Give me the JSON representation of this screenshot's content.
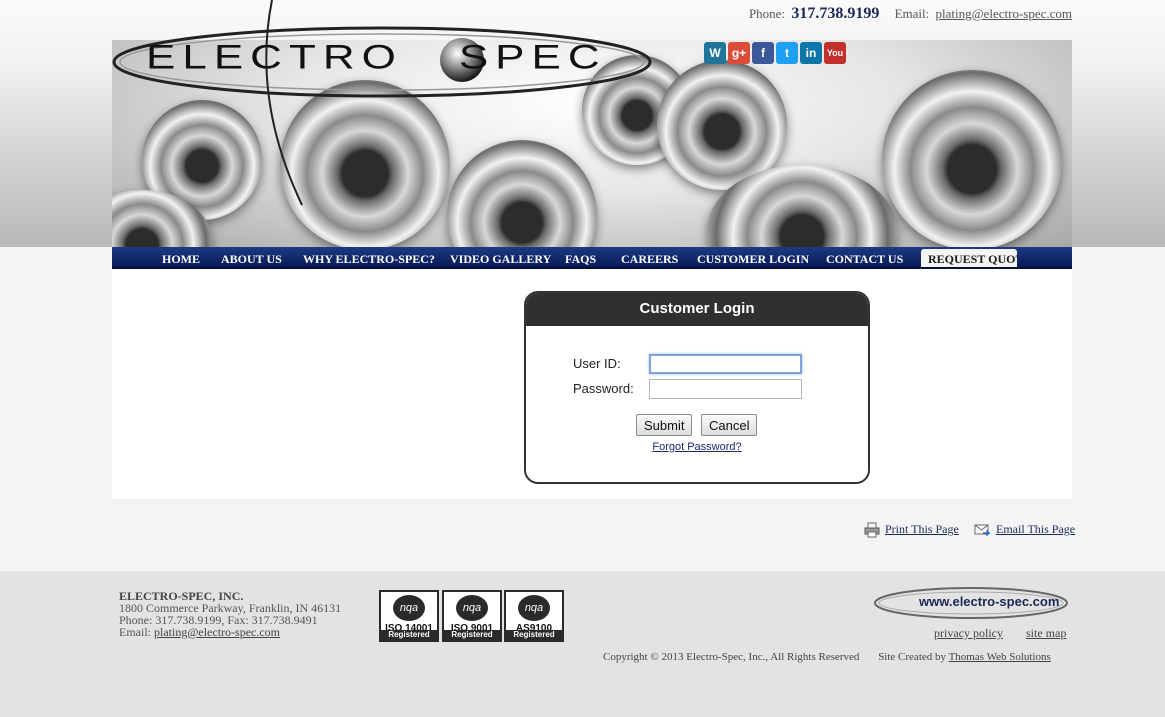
{
  "header": {
    "logo_text_left": "ELECTRO",
    "logo_text_right": "SPEC",
    "phone_label": "Phone:",
    "phone": "317.738.9199",
    "email_label": "Email:",
    "email": "plating@electro-spec.com",
    "social": [
      {
        "icon": "wordpress-icon",
        "glyph": "W",
        "color": "#21759b"
      },
      {
        "icon": "google-plus-icon",
        "glyph": "g+",
        "color": "#dd4b39"
      },
      {
        "icon": "facebook-icon",
        "glyph": "f",
        "color": "#3b5998"
      },
      {
        "icon": "twitter-icon",
        "glyph": "t",
        "color": "#1da1f2"
      },
      {
        "icon": "linkedin-icon",
        "glyph": "in",
        "color": "#0e76a8"
      },
      {
        "icon": "youtube-icon",
        "glyph": "You",
        "color": "#c4302b"
      }
    ]
  },
  "nav": {
    "items": [
      "HOME",
      "ABOUT US",
      "WHY ELECTRO-SPEC?",
      "VIDEO GALLERY",
      "FAQS",
      "CAREERS",
      "CUSTOMER LOGIN",
      "CONTACT US"
    ],
    "request_quote": "REQUEST QUOTE"
  },
  "login": {
    "title": "Customer Login",
    "user_label": "User ID:",
    "user_value": "",
    "password_label": "Password:",
    "password_value": "",
    "submit": "Submit",
    "cancel": "Cancel",
    "forgot": "Forgot Password?"
  },
  "utility": {
    "print": "Print This Page",
    "email": "Email This Page"
  },
  "footer": {
    "company": "ELECTRO-SPEC, INC.",
    "address": "1800 Commerce Parkway, Franklin, IN 46131",
    "phone_fax": "Phone: 317.738.9199, Fax: 317.738.9491",
    "email_label": "Email:",
    "email": "plating@electro-spec.com",
    "certs": [
      {
        "badge": "nqa",
        "standard": "ISO 14001",
        "label": "Registered"
      },
      {
        "badge": "nqa",
        "standard": "ISO 9001",
        "label": "Registered"
      },
      {
        "badge": "nqa",
        "standard": "AS9100",
        "label": "Registered"
      }
    ],
    "logo_text": "www.electro-spec.com",
    "privacy": "privacy policy",
    "sitemap": "site map",
    "copyright": "Copyright © 2013 Electro-Spec, Inc., All Rights Reserved",
    "created_by_label": "Site Created by",
    "created_by": "Thomas Web Solutions"
  }
}
